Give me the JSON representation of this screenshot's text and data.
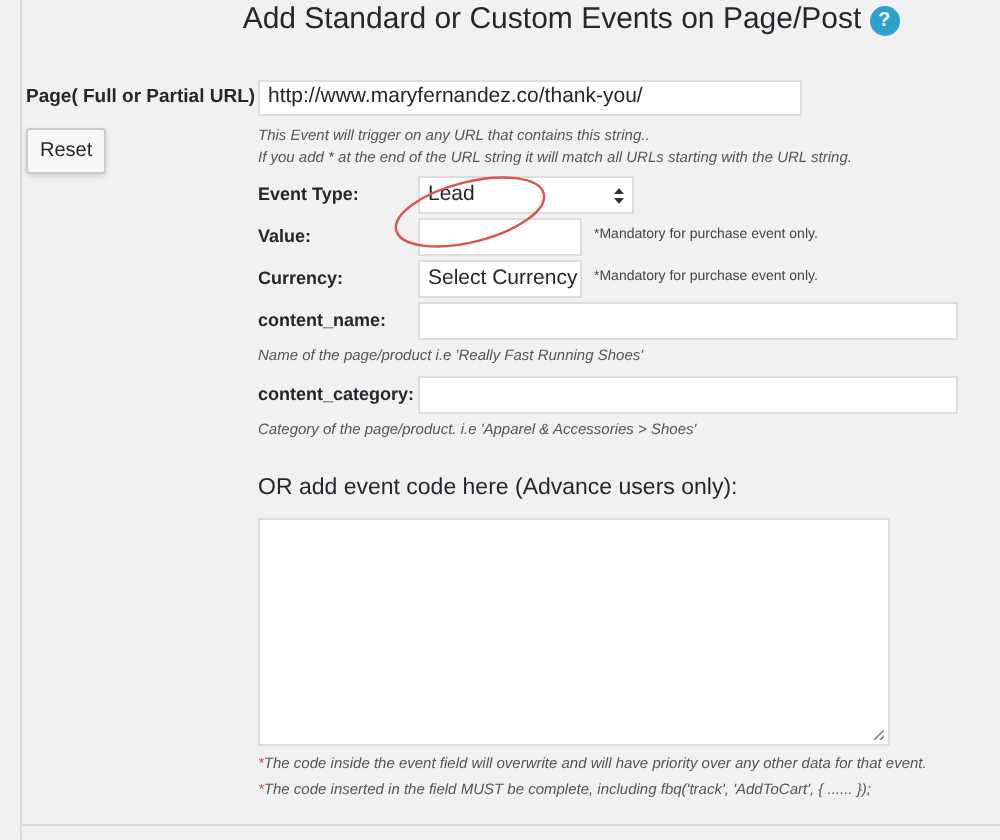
{
  "heading": {
    "title": "Add Standard or Custom Events on Page/Post",
    "help_icon": "?"
  },
  "page_label": "Page( Full or Partial URL)",
  "reset_button": "Reset",
  "url_field": {
    "value": "http://www.maryfernandez.co/thank-you/"
  },
  "url_hints": [
    "This Event will trigger on any URL that contains this string..",
    "If you add * at the end of the URL string it will match all URLs starting with the URL string."
  ],
  "fields": [
    {
      "kind": "select",
      "label": "Event Type:",
      "value": "Lead",
      "annotated": true
    },
    {
      "kind": "input",
      "label": "Value:",
      "note": "*Mandatory for purchase event only."
    },
    {
      "kind": "select",
      "label": "Currency:",
      "value": "Select Currency",
      "note": "*Mandatory for purchase event only."
    },
    {
      "kind": "input",
      "label": "content_name:",
      "hint": "Name of the page/product i.e 'Really Fast Running Shoes'"
    },
    {
      "kind": "input",
      "label": "content_category:",
      "hint": "Category of the page/product. i.e 'Apparel & Accessories > Shoes'"
    }
  ],
  "code_section": {
    "title": "OR add event code here (Advance users only):"
  },
  "notes": [
    {
      "marker": "*",
      "text": "The code inside the event field will overwrite and will have priority over any other data for that event."
    },
    {
      "marker": "*",
      "text": "The code inserted in the field MUST be complete, including fbq('track', 'AddToCart', { ...... });"
    }
  ]
}
